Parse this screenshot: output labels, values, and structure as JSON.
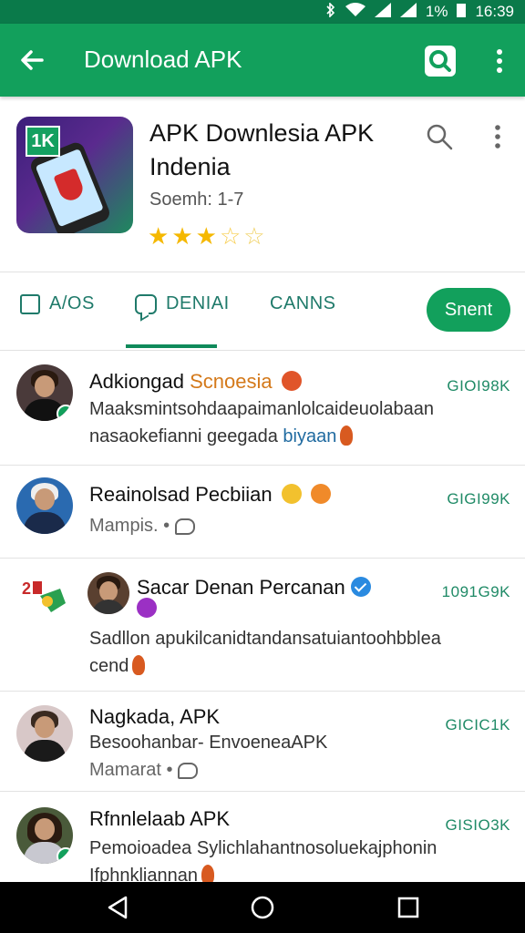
{
  "status_bar": {
    "battery": "1%",
    "time": "16:39"
  },
  "app_bar": {
    "title": "Download APK"
  },
  "app": {
    "name": "APK Downlesia APK Indenia",
    "subtitle": "Soemh: 1-7",
    "rating": 3.5
  },
  "tabs": [
    {
      "label": "A/OS"
    },
    {
      "label": "DENIAI"
    },
    {
      "label": "CANNS"
    }
  ],
  "send_button": {
    "label": "Snent"
  },
  "messages": [
    {
      "name": "Adkiongad",
      "name_suffix": "Scnoesia",
      "time": "GIOI98K",
      "line1": "Maaksmintsohdaapaimanlolcaideuolabaan",
      "line2": "nasaokefianni geegada",
      "line2_link": "biyaan"
    },
    {
      "name": "Reainolsad Pecbiian",
      "time": "GIGI99K",
      "line1": "Mampis. •"
    },
    {
      "name": "Sacar Denan Percanan",
      "time": "1091G9K",
      "line1": "Sadllon apukilcanidtandansatuiantoohbblea",
      "line2": "cend"
    },
    {
      "name": "Nagkada, APK",
      "time": "GICIC1K",
      "line1": "Besoohanbar- EnvoeneaAPK",
      "line2": "Mamarat •"
    },
    {
      "name": "Rfnnlelaab APK",
      "time": "GISIO3K",
      "line1": "Pemoioadea Sylichlahantnosoluekajphonin",
      "line2": "Ifphnkliannan"
    }
  ]
}
